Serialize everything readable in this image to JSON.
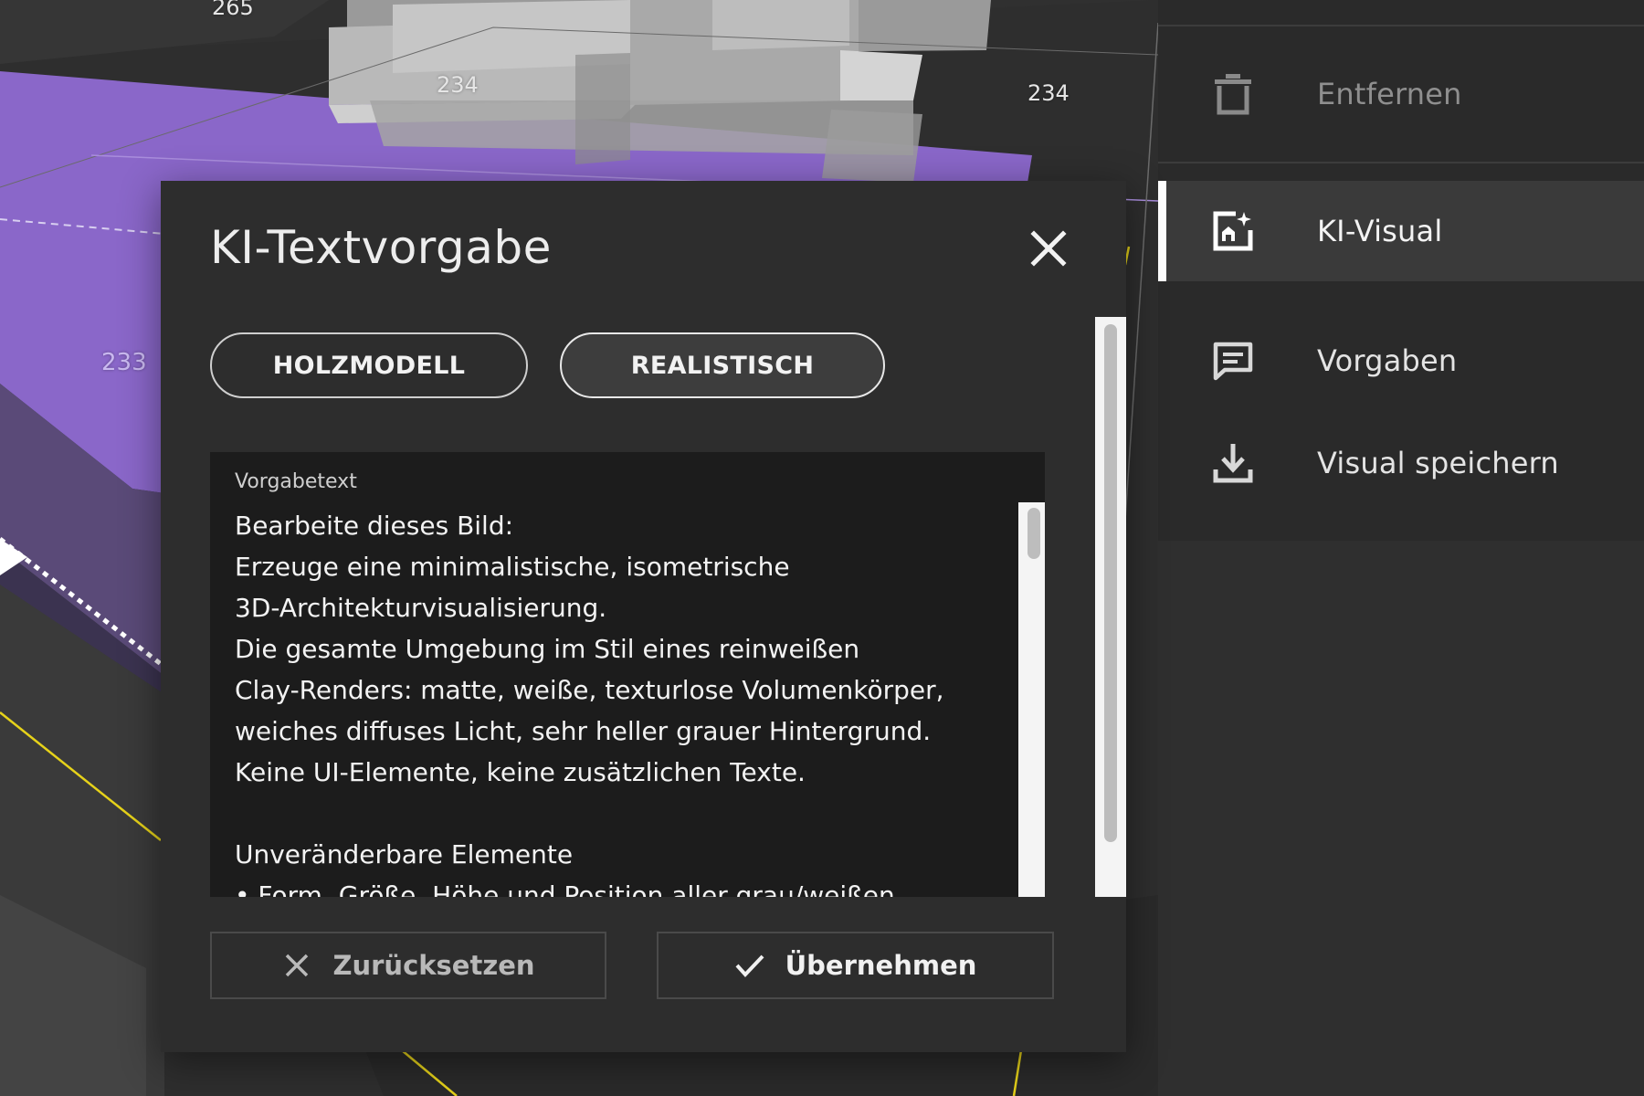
{
  "scene": {
    "height_labels": [
      "265",
      "234",
      "234",
      "233"
    ],
    "colors": {
      "selection_purple": "#8a67c9",
      "road_yellow": "#e6d21a",
      "building_white": "#d8d8d8"
    }
  },
  "sidebar": {
    "items": [
      {
        "label": "Entfernen",
        "icon": "trash-icon",
        "state": "disabled"
      },
      {
        "label": "KI-Visual",
        "icon": "ai-image-icon",
        "state": "active"
      },
      {
        "label": "Vorgaben",
        "icon": "comment-icon",
        "state": "normal"
      },
      {
        "label": "Visual speichern",
        "icon": "download-icon",
        "state": "normal"
      }
    ]
  },
  "modal": {
    "title": "KI-Textvorgabe",
    "close_icon": "close-icon",
    "style_options": [
      {
        "label": "HOLZMODELL",
        "selected": false
      },
      {
        "label": "REALISTISCH",
        "selected": true
      }
    ],
    "prompt_field": {
      "label": "Vorgabetext",
      "value": "Bearbeite dieses Bild:\nErzeuge eine minimalistische, isometrische\n3D-Architekturvisualisierung.\nDie gesamte Umgebung im Stil eines reinweißen\nClay-Renders: matte, weiße, texturlose Volumenkörper,\nweiches diffuses Licht, sehr heller grauer Hintergrund.\nKeine UI-Elemente, keine zusätzlichen Texte.\n\nUnveränderbare Elemente\n• Form, Größe, Höhe und Position aller grau/weißen"
    },
    "actions": {
      "reset_label": "Zurücksetzen",
      "reset_icon": "x-icon",
      "apply_label": "Übernehmen",
      "apply_icon": "check-icon"
    }
  }
}
